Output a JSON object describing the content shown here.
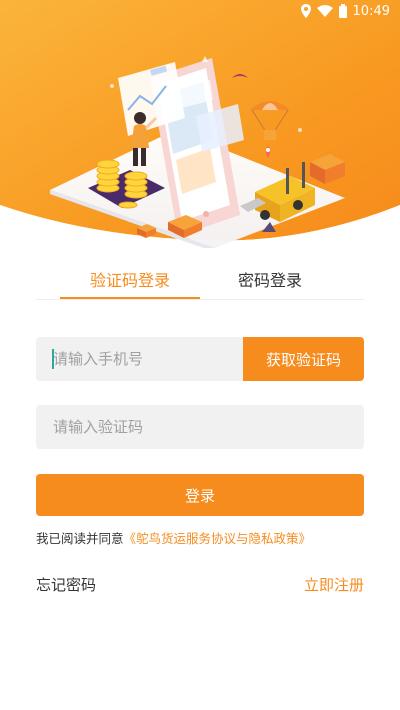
{
  "status_bar": {
    "time": "10:49",
    "icons": [
      "location-icon",
      "wifi-icon",
      "battery-icon"
    ]
  },
  "colors": {
    "accent": "#f68c1e",
    "field_bg": "#f0f1f0",
    "text_dark": "#333333",
    "placeholder": "#a0a0a0"
  },
  "tabs": [
    {
      "label": "验证码登录",
      "active": true
    },
    {
      "label": "密码登录",
      "active": false
    }
  ],
  "form": {
    "phone_placeholder": "请输入手机号",
    "phone_value": "",
    "code_placeholder": "请输入验证码",
    "code_value": "",
    "get_code_label": "获取验证码",
    "login_label": "登录"
  },
  "agreement": {
    "prefix": "我已阅读并同意",
    "link": "《鸵鸟货运服务协议与隐私政策》"
  },
  "footer": {
    "forgot_label": "忘记密码",
    "register_label": "立即注册"
  }
}
